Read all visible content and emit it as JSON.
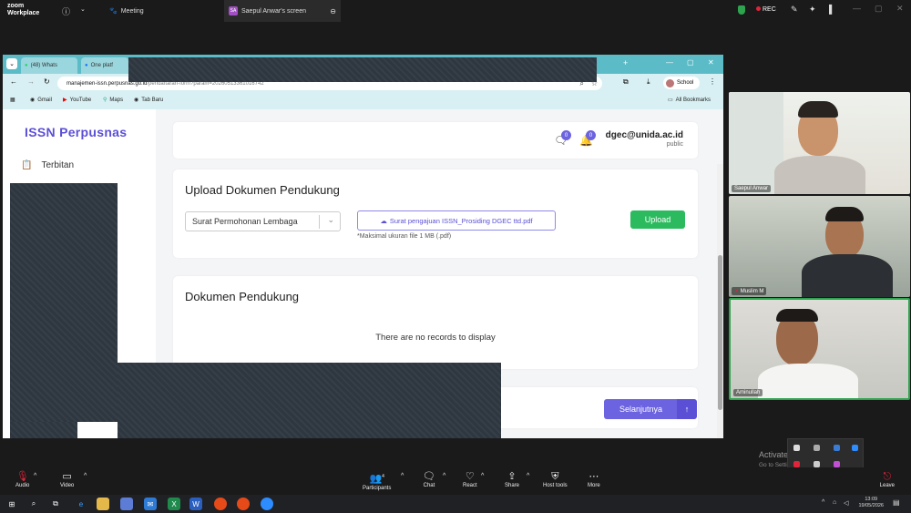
{
  "zoom": {
    "logo_line1": "zoom",
    "logo_line2": "Workplace",
    "meeting_tab": "Meeting",
    "screen_tab_badge": "SA",
    "screen_tab": "Saepul Anwar's screen",
    "rec": "REC"
  },
  "browser": {
    "tabs": [
      "(48) Whats",
      "One platf"
    ],
    "url_domain": "manajemen-issn.perpusnas.go.id",
    "url_path": "/pendaftaran-form?param=20260513361016742",
    "profile_label": "School",
    "bookmarks": [
      "Gmail",
      "YouTube",
      "Maps",
      "Tab Baru"
    ],
    "all_bookmarks": "All Bookmarks"
  },
  "page": {
    "brand": "ISSN Perpusnas",
    "nav_item": "Terbitan",
    "chat_count": "0",
    "notif_count": "0",
    "user_email": "dgec@unida.ac.id",
    "user_role": "public",
    "upload_title": "Upload Dokumen Pendukung",
    "doc_select_value": "Surat Permohonan Lembaga",
    "file_name": "Surat pengajuan ISSN_Prosiding DGEC ttd.pdf",
    "file_hint": "*Maksimal ukuran file 1 MB (.pdf)",
    "upload_button": "Upload",
    "docs_title": "Dokumen Pendukung",
    "no_records": "There are no records to display",
    "next_button": "Selanjutnya"
  },
  "participants": [
    {
      "name": "Saepul Anwar"
    },
    {
      "name": "Muslim M"
    },
    {
      "name": "Aminullah"
    }
  ],
  "activate": {
    "title": "Activate Windows",
    "subtitle": "Go to Settings to activate Windows."
  },
  "toolbar": {
    "audio": "Audio",
    "video": "Video",
    "participants": "Participants",
    "participants_count": "4",
    "chat": "Chat",
    "react": "React",
    "share": "Share",
    "host_tools": "Host tools",
    "more": "More",
    "leave": "Leave"
  },
  "clock": {
    "time": "13:09",
    "date": "19/05/2026"
  },
  "colors": {
    "accent": "#5b4fd6",
    "upload": "#2bbb5e",
    "chrome_tab_bar": "#5bbcc8"
  }
}
